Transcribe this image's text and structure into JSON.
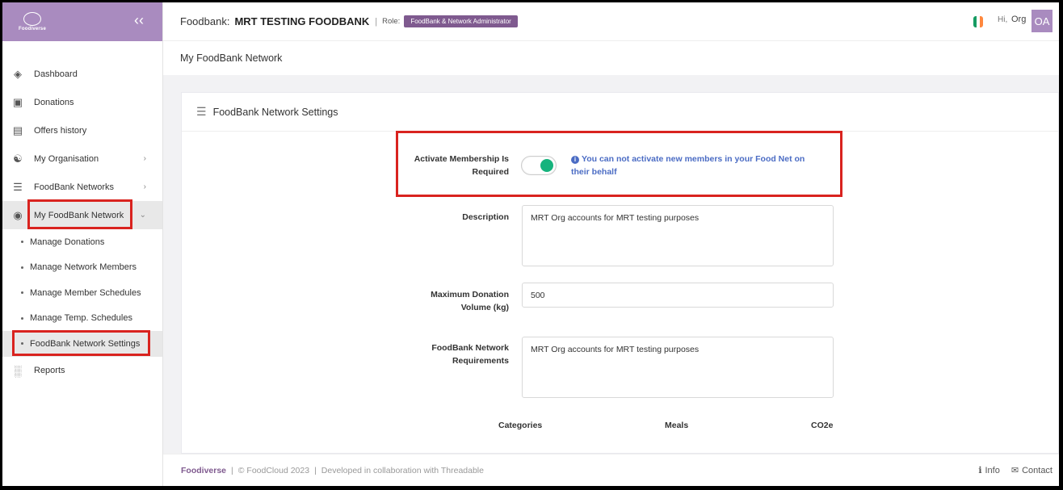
{
  "header": {
    "foodbank_label": "Foodbank:",
    "foodbank_name": "MRT TESTING FOODBANK",
    "separator": "|",
    "role_label": "Role:",
    "role_badge": "FoodBank & Network Administrator",
    "greeting": "Hi,",
    "user_name": "Org",
    "avatar_initials": "OA"
  },
  "brand": {
    "logo_text": "Foodiverse"
  },
  "sidebar": {
    "items": [
      {
        "label": "Dashboard",
        "icon": "layers-icon"
      },
      {
        "label": "Donations",
        "icon": "box-icon"
      },
      {
        "label": "Offers history",
        "icon": "cart-icon"
      },
      {
        "label": "My Organisation",
        "icon": "sitemap-icon"
      },
      {
        "label": "FoodBank Networks",
        "icon": "network-icon"
      },
      {
        "label": "My FoodBank Network",
        "icon": "globe-icon"
      },
      {
        "label": "Reports",
        "icon": "chart-icon"
      }
    ],
    "subitems": [
      {
        "label": "Manage Donations"
      },
      {
        "label": "Manage Network Members"
      },
      {
        "label": "Manage Member Schedules"
      },
      {
        "label": "Manage Temp. Schedules"
      },
      {
        "label": "FoodBank Network Settings"
      }
    ]
  },
  "page": {
    "title": "My FoodBank Network",
    "card_title": "FoodBank Network Settings"
  },
  "form": {
    "membership_label": "Activate Membership Is Required",
    "membership_toggle_on": true,
    "membership_note": "You can not activate new members in your Food Net on their behalf",
    "description_label": "Description",
    "description_value": "MRT Org accounts for MRT testing purposes",
    "max_donation_label": "Maximum Donation Volume (kg)",
    "max_donation_value": "500",
    "requirements_label": "FoodBank Network Requirements",
    "requirements_value": "MRT Org accounts for MRT testing purposes",
    "table_headers": [
      "Categories",
      "Meals",
      "CO2e"
    ]
  },
  "footer": {
    "brand": "Foodiverse",
    "copyright": "© FoodCloud 2023",
    "collab": "Developed in collaboration with Threadable",
    "info": "Info",
    "contact": "Contact"
  },
  "colors": {
    "brand_purple": "#a98bbf",
    "badge_purple": "#7f5a8f",
    "toggle_green": "#16b37d",
    "info_blue": "#4b6cc4",
    "highlight_red": "#d9231f"
  }
}
